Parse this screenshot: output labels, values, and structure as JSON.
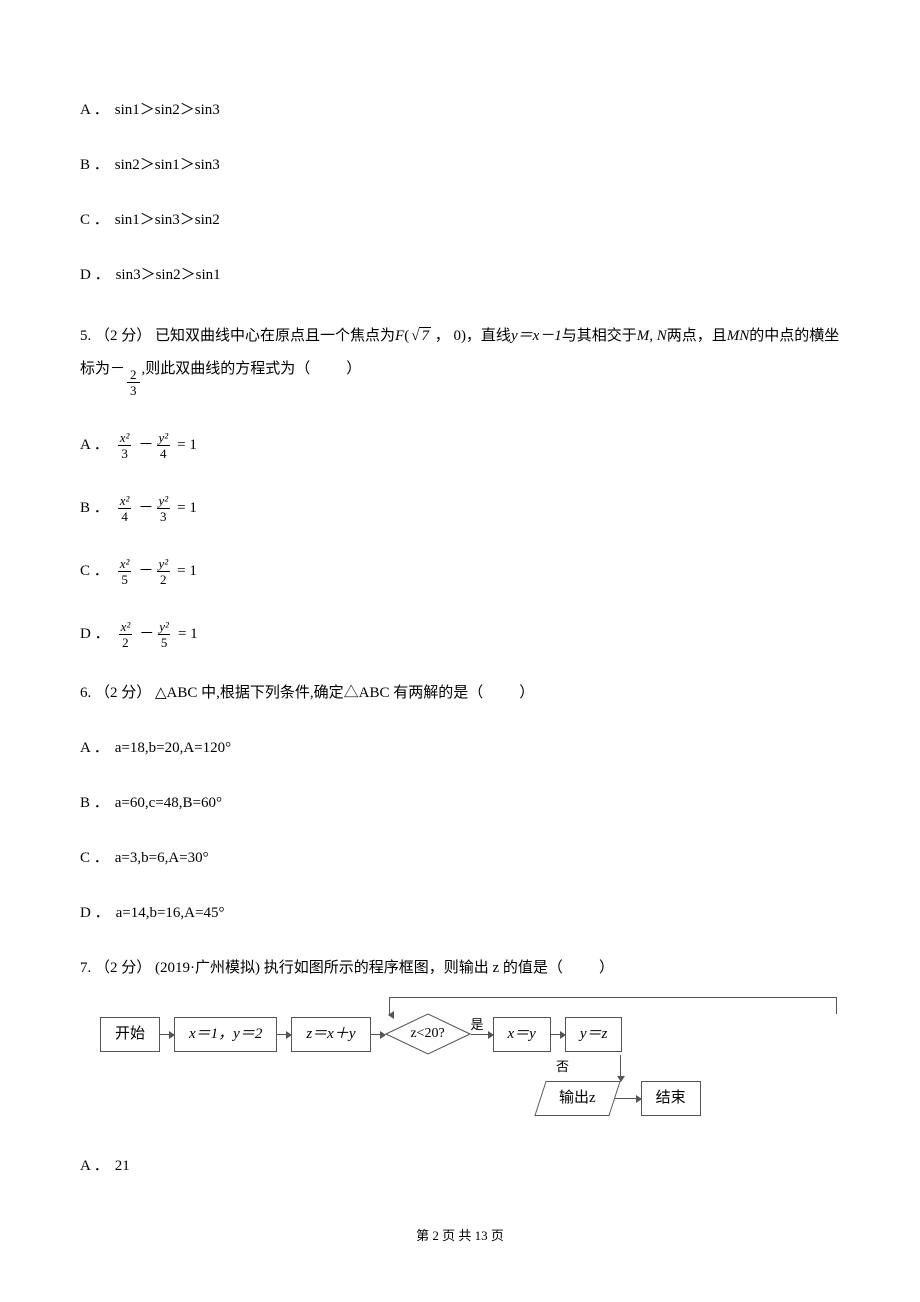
{
  "q4_options": {
    "A": "sin1＞sin2＞sin3",
    "B": "sin2＞sin1＞sin3",
    "C": "sin1＞sin3＞sin2",
    "D": "sin3＞sin2＞sin1"
  },
  "q5": {
    "num": "5.",
    "points": "（2 分）",
    "stem_p1": "已知双曲线中心在原点且一个焦点为",
    "focus_F": "F",
    "focus_open": "(",
    "sqrt_expr": "7",
    "focus_rest": " ， 0)，直线",
    "line_eq": "y＝x－1",
    "stem_p3": "与其相交于",
    "pts_MN": "M, N",
    "stem_p4": "两点，且",
    "mn_ital": "MN",
    "stem_p5": "的中点的横坐标为",
    "neg": "－",
    "mid_num": "2",
    "mid_den": "3",
    "stem_p6": ",则此双曲线的方程式为（",
    "close_paren": "）",
    "options": {
      "A": {
        "n1": "x²",
        "d1": "3",
        "n2": "y²",
        "d2": "4"
      },
      "B": {
        "n1": "x²",
        "d1": "4",
        "n2": "y²",
        "d2": "3"
      },
      "C": {
        "n1": "x²",
        "d1": "5",
        "n2": "y²",
        "d2": "2"
      },
      "D": {
        "n1": "x²",
        "d1": "2",
        "n2": "y²",
        "d2": "5"
      }
    },
    "eq_rest": "= 1"
  },
  "q6": {
    "num": "6.",
    "points": "（2 分）",
    "stem": "△ABC 中,根据下列条件,确定△ABC 有两解的是（",
    "close_paren": "）",
    "options": {
      "A": "a=18,b=20,A=120°",
      "B": "a=60,c=48,B=60°",
      "C": "a=3,b=6,A=30°",
      "D": "a=14,b=16,A=45°"
    }
  },
  "q7": {
    "num": "7.",
    "points": "（2 分）",
    "source": "(2019·广州模拟)",
    "stem": "执行如图所示的程序框图，则输出 z 的值是（",
    "close_paren": "）",
    "flow": {
      "start": "开始",
      "init": "x＝1，y＝2",
      "assign": "z＝x＋y",
      "cond": "z<20?",
      "yes": "是",
      "no": "否",
      "step1": "x＝y",
      "step2": "y＝z",
      "output": "输出z",
      "end": "结束"
    },
    "options": {
      "A": "21"
    }
  },
  "footer": "第 2 页 共 13 页"
}
